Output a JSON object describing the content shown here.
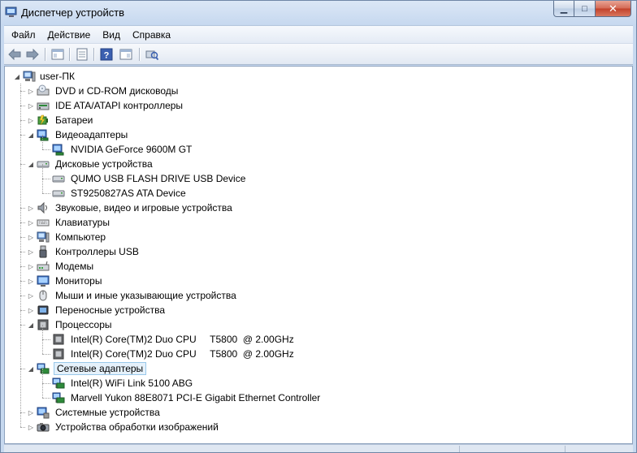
{
  "window": {
    "title": "Диспетчер устройств",
    "min_glyph": "▁",
    "max_glyph": "□",
    "close_glyph": "✕"
  },
  "menu": [
    "Файл",
    "Действие",
    "Вид",
    "Справка"
  ],
  "toolbar": {
    "icons": [
      "back-icon",
      "forward-icon",
      "properties-list-icon",
      "document-icon",
      "help-icon",
      "console-icon",
      "scan-hardware-icon"
    ]
  },
  "tree": {
    "root": "user-ПК",
    "categories": [
      {
        "label": "DVD и CD-ROM дисководы",
        "icon": "dvd-drive-icon",
        "expanded": false,
        "children": []
      },
      {
        "label": "IDE ATA/ATAPI контроллеры",
        "icon": "ide-controller-icon",
        "expanded": false,
        "children": []
      },
      {
        "label": "Батареи",
        "icon": "battery-icon",
        "expanded": false,
        "children": []
      },
      {
        "label": "Видеоадаптеры",
        "icon": "display-adapter-icon",
        "expanded": true,
        "children": [
          {
            "label": "NVIDIA GeForce 9600M GT",
            "icon": "display-adapter-icon"
          }
        ]
      },
      {
        "label": "Дисковые устройства",
        "icon": "disk-drive-icon",
        "expanded": true,
        "children": [
          {
            "label": "QUMO USB FLASH DRIVE USB Device",
            "icon": "disk-drive-icon"
          },
          {
            "label": "ST9250827AS ATA Device",
            "icon": "disk-drive-icon"
          }
        ]
      },
      {
        "label": "Звуковые, видео и игровые устройства",
        "icon": "speaker-icon",
        "expanded": false,
        "children": []
      },
      {
        "label": "Клавиатуры",
        "icon": "keyboard-icon",
        "expanded": false,
        "children": []
      },
      {
        "label": "Компьютер",
        "icon": "computer-icon",
        "expanded": false,
        "children": []
      },
      {
        "label": "Контроллеры USB",
        "icon": "usb-icon",
        "expanded": false,
        "children": []
      },
      {
        "label": "Модемы",
        "icon": "modem-icon",
        "expanded": false,
        "children": []
      },
      {
        "label": "Мониторы",
        "icon": "monitor-icon",
        "expanded": false,
        "children": []
      },
      {
        "label": "Мыши и иные указывающие устройства",
        "icon": "mouse-icon",
        "expanded": false,
        "children": []
      },
      {
        "label": "Переносные устройства",
        "icon": "portable-device-icon",
        "expanded": false,
        "children": []
      },
      {
        "label": "Процессоры",
        "icon": "processor-icon",
        "expanded": true,
        "children": [
          {
            "label": "Intel(R) Core(TM)2 Duo CPU     T5800  @ 2.00GHz",
            "icon": "processor-icon"
          },
          {
            "label": "Intel(R) Core(TM)2 Duo CPU     T5800  @ 2.00GHz",
            "icon": "processor-icon"
          }
        ]
      },
      {
        "label": "Сетевые адаптеры",
        "icon": "network-adapter-icon",
        "expanded": true,
        "selected": true,
        "children": [
          {
            "label": "Intel(R) WiFi Link 5100 ABG",
            "icon": "network-adapter-icon"
          },
          {
            "label": "Marvell Yukon 88E8071 PCI-E Gigabit Ethernet Controller",
            "icon": "network-adapter-icon"
          }
        ]
      },
      {
        "label": "Системные устройства",
        "icon": "system-device-icon",
        "expanded": false,
        "children": []
      },
      {
        "label": "Устройства обработки изображений",
        "icon": "imaging-device-icon",
        "expanded": false,
        "children": []
      }
    ]
  }
}
